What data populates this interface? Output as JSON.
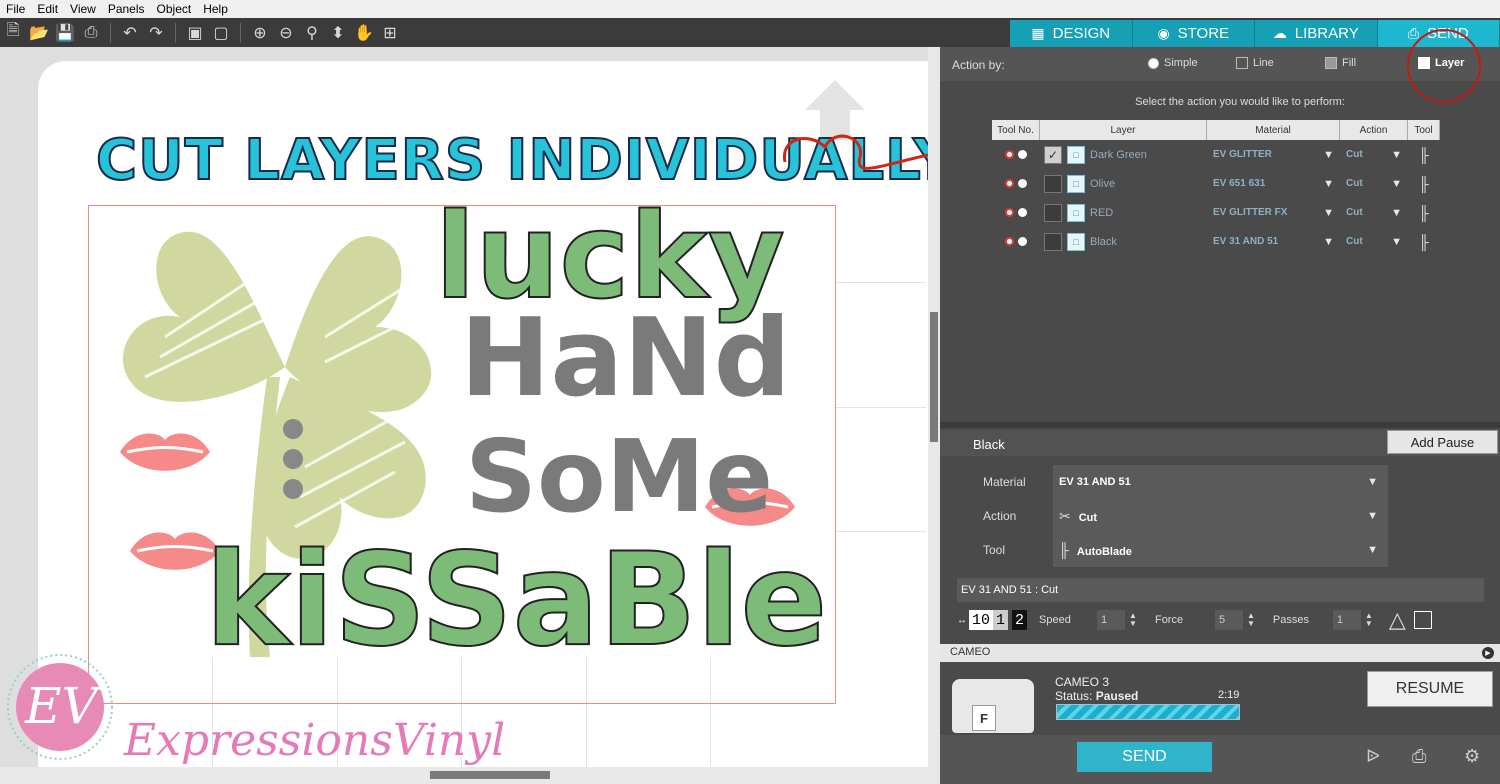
{
  "menu": [
    "File",
    "Edit",
    "View",
    "Panels",
    "Object",
    "Help"
  ],
  "toolbar_icons": [
    "new-icon",
    "open-icon",
    "save-icon",
    "print-icon",
    "undo-icon",
    "redo-icon",
    "group-icon",
    "ungroup-icon",
    "zoom-in-icon",
    "zoom-out-icon",
    "zoom-fit-icon",
    "move-icon",
    "pan-icon",
    "add-page-icon"
  ],
  "nav_tabs": [
    {
      "label": "DESIGN",
      "icon": "grid-icon"
    },
    {
      "label": "STORE",
      "icon": "store-icon"
    },
    {
      "label": "LIBRARY",
      "icon": "cloud-icon"
    },
    {
      "label": "SEND",
      "icon": "cutter-icon",
      "active": true
    }
  ],
  "canvas": {
    "overlay_title": "CUT LAYERS INDIVIDUALLY...",
    "design_lines": [
      "lucky",
      "HaNd",
      "SoMe",
      "kiSSaBle"
    ],
    "brand": "ExpressionsVinyl",
    "logo_initials": "EV"
  },
  "panel": {
    "action_by_label": "Action by:",
    "options": [
      {
        "label": "Simple",
        "selected": false
      },
      {
        "label": "Line",
        "selected": false
      },
      {
        "label": "Fill",
        "selected": false
      },
      {
        "label": "Layer",
        "selected": true
      }
    ],
    "instruction": "Select the action you would like to perform:",
    "table_headers": [
      "Tool No.",
      "Layer",
      "Material",
      "Action",
      "Tool"
    ],
    "layers": [
      {
        "name": "Dark Green",
        "checked": true,
        "material": "EV GLITTER",
        "action": "Cut"
      },
      {
        "name": "Olive",
        "checked": false,
        "material": "EV 651 631",
        "action": "Cut"
      },
      {
        "name": "RED",
        "checked": false,
        "material": "EV GLITTER FX",
        "action": "Cut"
      },
      {
        "name": "Black",
        "checked": false,
        "material": "EV 31 AND 51",
        "action": "Cut"
      }
    ],
    "selected_layer": "Black",
    "add_pause": "Add Pause",
    "props": [
      {
        "label": "Material",
        "value": "EV 31 AND 51",
        "icon": ""
      },
      {
        "label": "Action",
        "value": "Cut",
        "icon": "cut-icon"
      },
      {
        "label": "Tool",
        "value": "AutoBlade",
        "icon": "blade-icon"
      }
    ],
    "cut_header": "EV 31 AND 51 : Cut",
    "blade_depth": [
      "10",
      "1",
      "2"
    ],
    "speed_label": "Speed",
    "speed": "1",
    "force_label": "Force",
    "force": "5",
    "passes_label": "Passes",
    "passes": "1",
    "cameo_bar": "CAMEO",
    "device": {
      "name": "CAMEO 3",
      "status_label": "Status:",
      "status": "Paused",
      "time": "2:19",
      "progress": 1.0
    },
    "resume": "RESUME",
    "send": "SEND"
  }
}
